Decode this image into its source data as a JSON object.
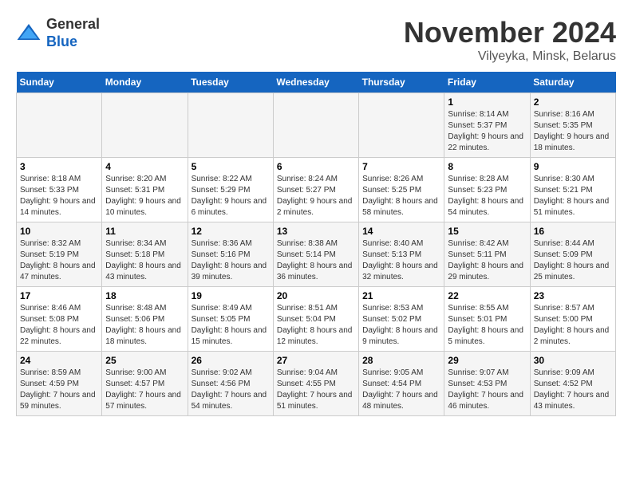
{
  "logo": {
    "general": "General",
    "blue": "Blue"
  },
  "title": "November 2024",
  "subtitle": "Vilyeyka, Minsk, Belarus",
  "days_of_week": [
    "Sunday",
    "Monday",
    "Tuesday",
    "Wednesday",
    "Thursday",
    "Friday",
    "Saturday"
  ],
  "weeks": [
    [
      {
        "day": "",
        "info": ""
      },
      {
        "day": "",
        "info": ""
      },
      {
        "day": "",
        "info": ""
      },
      {
        "day": "",
        "info": ""
      },
      {
        "day": "",
        "info": ""
      },
      {
        "day": "1",
        "info": "Sunrise: 8:14 AM\nSunset: 5:37 PM\nDaylight: 9 hours and 22 minutes."
      },
      {
        "day": "2",
        "info": "Sunrise: 8:16 AM\nSunset: 5:35 PM\nDaylight: 9 hours and 18 minutes."
      }
    ],
    [
      {
        "day": "3",
        "info": "Sunrise: 8:18 AM\nSunset: 5:33 PM\nDaylight: 9 hours and 14 minutes."
      },
      {
        "day": "4",
        "info": "Sunrise: 8:20 AM\nSunset: 5:31 PM\nDaylight: 9 hours and 10 minutes."
      },
      {
        "day": "5",
        "info": "Sunrise: 8:22 AM\nSunset: 5:29 PM\nDaylight: 9 hours and 6 minutes."
      },
      {
        "day": "6",
        "info": "Sunrise: 8:24 AM\nSunset: 5:27 PM\nDaylight: 9 hours and 2 minutes."
      },
      {
        "day": "7",
        "info": "Sunrise: 8:26 AM\nSunset: 5:25 PM\nDaylight: 8 hours and 58 minutes."
      },
      {
        "day": "8",
        "info": "Sunrise: 8:28 AM\nSunset: 5:23 PM\nDaylight: 8 hours and 54 minutes."
      },
      {
        "day": "9",
        "info": "Sunrise: 8:30 AM\nSunset: 5:21 PM\nDaylight: 8 hours and 51 minutes."
      }
    ],
    [
      {
        "day": "10",
        "info": "Sunrise: 8:32 AM\nSunset: 5:19 PM\nDaylight: 8 hours and 47 minutes."
      },
      {
        "day": "11",
        "info": "Sunrise: 8:34 AM\nSunset: 5:18 PM\nDaylight: 8 hours and 43 minutes."
      },
      {
        "day": "12",
        "info": "Sunrise: 8:36 AM\nSunset: 5:16 PM\nDaylight: 8 hours and 39 minutes."
      },
      {
        "day": "13",
        "info": "Sunrise: 8:38 AM\nSunset: 5:14 PM\nDaylight: 8 hours and 36 minutes."
      },
      {
        "day": "14",
        "info": "Sunrise: 8:40 AM\nSunset: 5:13 PM\nDaylight: 8 hours and 32 minutes."
      },
      {
        "day": "15",
        "info": "Sunrise: 8:42 AM\nSunset: 5:11 PM\nDaylight: 8 hours and 29 minutes."
      },
      {
        "day": "16",
        "info": "Sunrise: 8:44 AM\nSunset: 5:09 PM\nDaylight: 8 hours and 25 minutes."
      }
    ],
    [
      {
        "day": "17",
        "info": "Sunrise: 8:46 AM\nSunset: 5:08 PM\nDaylight: 8 hours and 22 minutes."
      },
      {
        "day": "18",
        "info": "Sunrise: 8:48 AM\nSunset: 5:06 PM\nDaylight: 8 hours and 18 minutes."
      },
      {
        "day": "19",
        "info": "Sunrise: 8:49 AM\nSunset: 5:05 PM\nDaylight: 8 hours and 15 minutes."
      },
      {
        "day": "20",
        "info": "Sunrise: 8:51 AM\nSunset: 5:04 PM\nDaylight: 8 hours and 12 minutes."
      },
      {
        "day": "21",
        "info": "Sunrise: 8:53 AM\nSunset: 5:02 PM\nDaylight: 8 hours and 9 minutes."
      },
      {
        "day": "22",
        "info": "Sunrise: 8:55 AM\nSunset: 5:01 PM\nDaylight: 8 hours and 5 minutes."
      },
      {
        "day": "23",
        "info": "Sunrise: 8:57 AM\nSunset: 5:00 PM\nDaylight: 8 hours and 2 minutes."
      }
    ],
    [
      {
        "day": "24",
        "info": "Sunrise: 8:59 AM\nSunset: 4:59 PM\nDaylight: 7 hours and 59 minutes."
      },
      {
        "day": "25",
        "info": "Sunrise: 9:00 AM\nSunset: 4:57 PM\nDaylight: 7 hours and 57 minutes."
      },
      {
        "day": "26",
        "info": "Sunrise: 9:02 AM\nSunset: 4:56 PM\nDaylight: 7 hours and 54 minutes."
      },
      {
        "day": "27",
        "info": "Sunrise: 9:04 AM\nSunset: 4:55 PM\nDaylight: 7 hours and 51 minutes."
      },
      {
        "day": "28",
        "info": "Sunrise: 9:05 AM\nSunset: 4:54 PM\nDaylight: 7 hours and 48 minutes."
      },
      {
        "day": "29",
        "info": "Sunrise: 9:07 AM\nSunset: 4:53 PM\nDaylight: 7 hours and 46 minutes."
      },
      {
        "day": "30",
        "info": "Sunrise: 9:09 AM\nSunset: 4:52 PM\nDaylight: 7 hours and 43 minutes."
      }
    ]
  ]
}
